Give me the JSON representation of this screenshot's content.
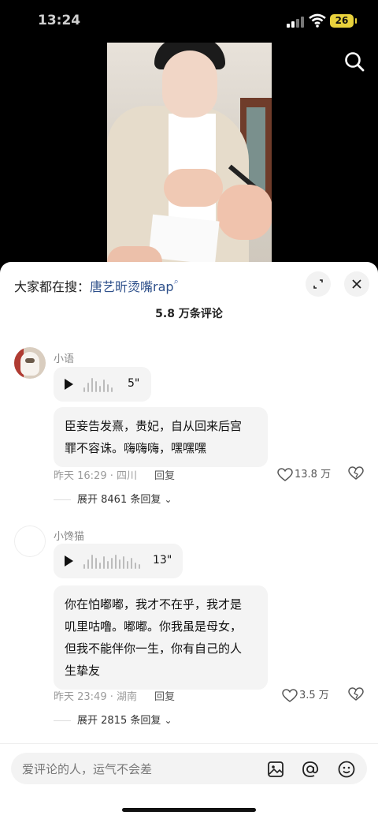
{
  "status_bar": {
    "time": "13:24",
    "battery": "26"
  },
  "video": {
    "search_icon": "magnifier-icon"
  },
  "sheet": {
    "hint_prefix": "大家都在搜：",
    "hint_keyword": "唐艺昕烫嘴rap",
    "hint_icon": "⌕",
    "comment_count": "5.8 万条评论",
    "icons": {
      "expand": "expand-icon",
      "close": "close-icon"
    }
  },
  "comments": [
    {
      "username": "小语",
      "voice_duration": "5\"",
      "text_line1": "臣妾告发熹，贵妃，自从回来后宫",
      "text_line2": "罪不容诛。嗨嗨嗨，嘿嘿嘿",
      "time": "昨天 16:29 · 四川",
      "reply": "回复",
      "likes": "13.8 万",
      "expand": "展开 8461 条回复"
    },
    {
      "username": "小馋猫",
      "voice_duration": "13\"",
      "text_line1": "你在怕嘟嘟，我才不在乎，我才是",
      "text_line2": "叽里咕噜。嘟嘟。你我虽是母女，",
      "text_line3": "但我不能伴你一生，你有自己的人",
      "text_line4": "生挚友",
      "time": "昨天 23:49 · 湖南",
      "reply": "回复",
      "likes": "3.5 万",
      "expand": "展开 2815 条回复"
    }
  ],
  "input": {
    "placeholder": "爱评论的人，运气不会差",
    "icons": [
      "image-icon",
      "at-icon",
      "emoji-icon"
    ]
  }
}
